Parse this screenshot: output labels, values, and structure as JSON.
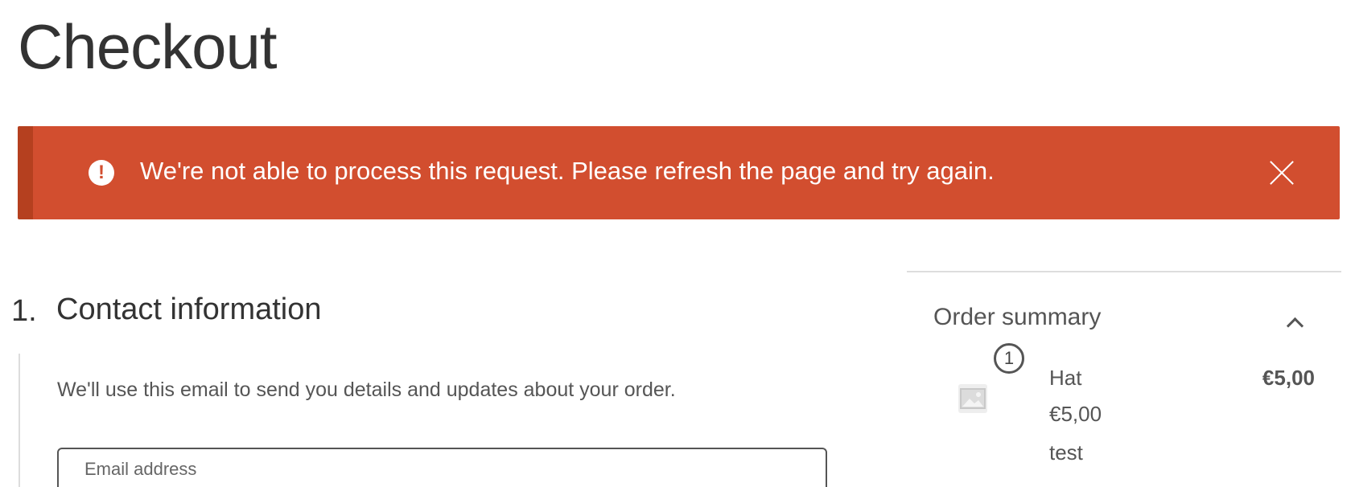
{
  "page": {
    "title": "Checkout"
  },
  "notice": {
    "message": "We're not able to process this request. Please refresh the page and try again.",
    "icon": "exclamation",
    "close_icon": "close",
    "background_color": "#d24e2f",
    "accent_color": "#b5401f"
  },
  "contact": {
    "step_number": "1.",
    "title": "Contact information",
    "description": "We'll use this email to send you details and updates about your order.",
    "email_label": "Email address"
  },
  "order_summary": {
    "title": "Order summary",
    "toggle_icon": "chevron-up",
    "items": [
      {
        "quantity": "1",
        "name": "Hat",
        "unit_price": "€5,00",
        "meta": "test",
        "total": "€5,00",
        "image_icon": "image-placeholder"
      }
    ]
  }
}
